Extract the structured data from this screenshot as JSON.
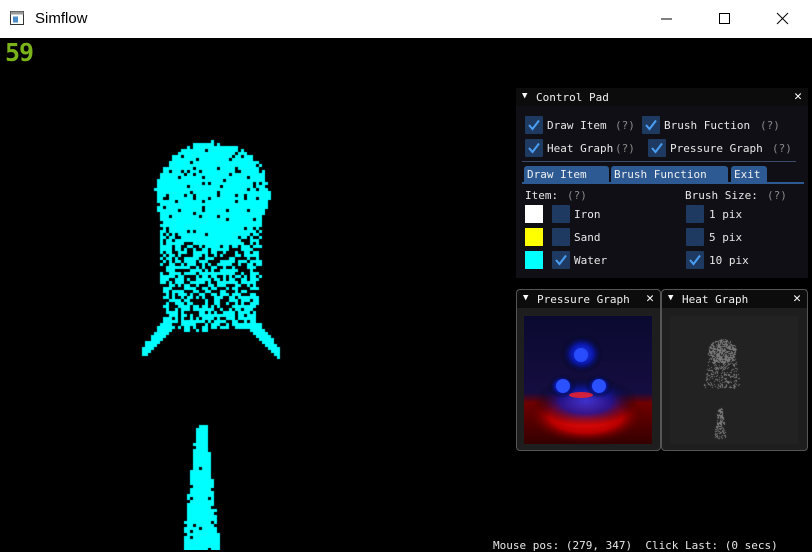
{
  "window": {
    "title": "Simflow"
  },
  "canvas": {
    "fps": "59",
    "status_text": "Mouse pos: (279, 347)  Click Last: (0 secs)"
  },
  "control_pad": {
    "title": "Control Pad",
    "toggles": [
      {
        "label": "Draw Item",
        "checked": true,
        "help": "(?)"
      },
      {
        "label": "Brush Fuction",
        "checked": true,
        "help": "(?)"
      },
      {
        "label": "Heat Graph",
        "checked": true,
        "help": "(?)"
      },
      {
        "label": "Pressure Graph",
        "checked": true,
        "help": "(?)"
      }
    ],
    "tabs": [
      "Draw Item",
      "Brush Function",
      "Exit"
    ],
    "item_header": "Item:",
    "item_help": "(?)",
    "items": [
      {
        "label": "Iron",
        "color": "#ffffff",
        "checked": false
      },
      {
        "label": "Sand",
        "color": "#ffff00",
        "checked": false
      },
      {
        "label": "Water",
        "color": "#00ffff",
        "checked": true
      }
    ],
    "brush_header": "Brush Size:",
    "brush_help": "(?)",
    "brush_sizes": [
      {
        "label": "1 pix",
        "checked": false
      },
      {
        "label": "5 pix",
        "checked": false
      },
      {
        "label": "10 pix",
        "checked": true
      }
    ]
  },
  "pressure_graph": {
    "title": "Pressure Graph"
  },
  "heat_graph": {
    "title": "Heat Graph"
  },
  "colors": {
    "water": "#00ffff",
    "fps": "#7ab21a",
    "checkbox": "#1f3a60",
    "check": "#4a9ff5",
    "tab": "#2e5a93"
  }
}
